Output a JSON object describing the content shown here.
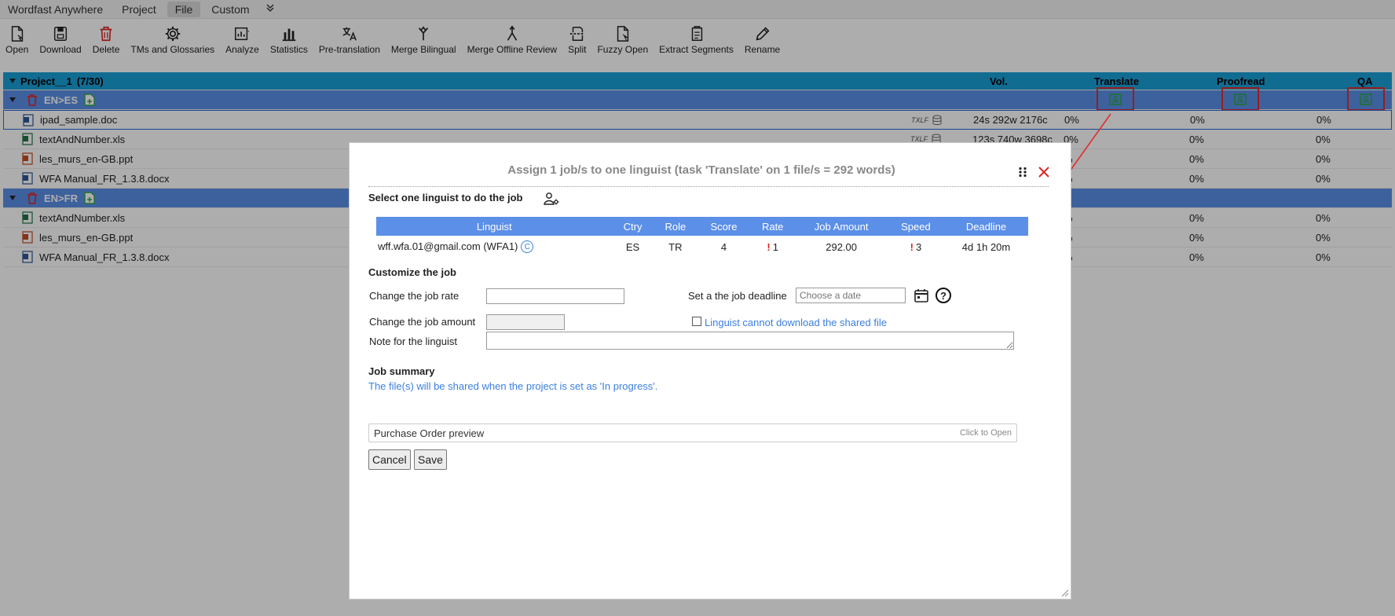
{
  "menubar": {
    "items": [
      "Wordfast Anywhere",
      "Project",
      "File",
      "Custom"
    ],
    "active_index": 2
  },
  "toolbar": {
    "items": [
      {
        "label": "Open",
        "icon": "file-open-icon"
      },
      {
        "label": "Download",
        "icon": "download-icon"
      },
      {
        "label": "Delete",
        "icon": "trash-icon"
      },
      {
        "label": "TMs and Glossaries",
        "icon": "gear-icon"
      },
      {
        "label": "Analyze",
        "icon": "analyze-icon"
      },
      {
        "label": "Statistics",
        "icon": "bar-chart-icon"
      },
      {
        "label": "Pre-translation",
        "icon": "translate-icon"
      },
      {
        "label": "Merge Bilingual",
        "icon": "merge-icon"
      },
      {
        "label": "Merge Offline Review",
        "icon": "merge-review-icon"
      },
      {
        "label": "Split",
        "icon": "split-icon"
      },
      {
        "label": "Fuzzy Open",
        "icon": "fuzzy-open-icon"
      },
      {
        "label": "Extract Segments",
        "icon": "extract-icon"
      },
      {
        "label": "Rename",
        "icon": "pencil-icon"
      }
    ]
  },
  "project": {
    "name": "Project__1",
    "count": "(7/30)",
    "columns": {
      "vol": "Vol.",
      "translate": "Translate",
      "proofread": "Proofread",
      "qa": "QA"
    },
    "groups": [
      {
        "lang": "EN>ES",
        "files": [
          {
            "name": "ipad_sample.doc",
            "type": "TXLF",
            "vol": "24s 292w 2176c",
            "t": "0%",
            "p": "0%",
            "q": "0%"
          },
          {
            "name": "textAndNumber.xls",
            "type": "TXLF",
            "vol": "123s 740w 3698c",
            "t": "0%",
            "p": "0%",
            "q": "0%"
          },
          {
            "name": "les_murs_en-GB.ppt",
            "type": "",
            "vol": "",
            "t": "%",
            "p": "0%",
            "q": "0%"
          },
          {
            "name": "WFA Manual_FR_1.3.8.docx",
            "type": "",
            "vol": "",
            "t": "%",
            "p": "0%",
            "q": "0%"
          }
        ]
      },
      {
        "lang": "EN>FR",
        "files": [
          {
            "name": "textAndNumber.xls",
            "type": "",
            "vol": "",
            "t": "%",
            "p": "0%",
            "q": "0%"
          },
          {
            "name": "les_murs_en-GB.ppt",
            "type": "",
            "vol": "",
            "t": "%",
            "p": "0%",
            "q": "0%"
          },
          {
            "name": "WFA Manual_FR_1.3.8.docx",
            "type": "",
            "vol": "",
            "t": "%",
            "p": "0%",
            "q": "0%"
          }
        ]
      }
    ]
  },
  "dialog": {
    "title": "Assign 1 job/s to one linguist (task 'Translate' on 1 file/s = 292 words)",
    "select_heading": "Select one linguist to do the job",
    "table": {
      "headers": [
        "Linguist",
        "Ctry",
        "Role",
        "Score",
        "Rate",
        "Job Amount",
        "Speed",
        "Deadline"
      ],
      "rows": [
        {
          "linguist": "wff.wfa.01@gmail.com (WFA1)",
          "badge": "C",
          "ctry": "ES",
          "role": "TR",
          "score": "4",
          "rate_warn": "!",
          "rate": "1",
          "amount": "292.00",
          "speed_warn": "!",
          "speed": "3",
          "deadline": "4d 1h 20m"
        }
      ]
    },
    "customize_heading": "Customize the job",
    "rate_label": "Change the job rate",
    "rate_value": "",
    "deadline_label": "Set a the job deadline",
    "deadline_placeholder": "Choose a date",
    "amount_label": "Change the job amount",
    "amount_value": "",
    "cannot_download_label": "Linguist cannot download the shared file",
    "note_label": "Note for the linguist",
    "note_value": "",
    "summary_heading": "Job summary",
    "summary_text": "The file(s) will be shared when the project is set as 'In progress'.",
    "po_label": "Purchase Order preview",
    "po_hint": "Click to Open",
    "cancel_label": "Cancel",
    "save_label": "Save"
  },
  "colors": {
    "project_row": "#1aa0d8",
    "lang_row": "#5b8fe8",
    "highlight_red": "#e32c2c",
    "link_blue": "#3b7fe0"
  }
}
